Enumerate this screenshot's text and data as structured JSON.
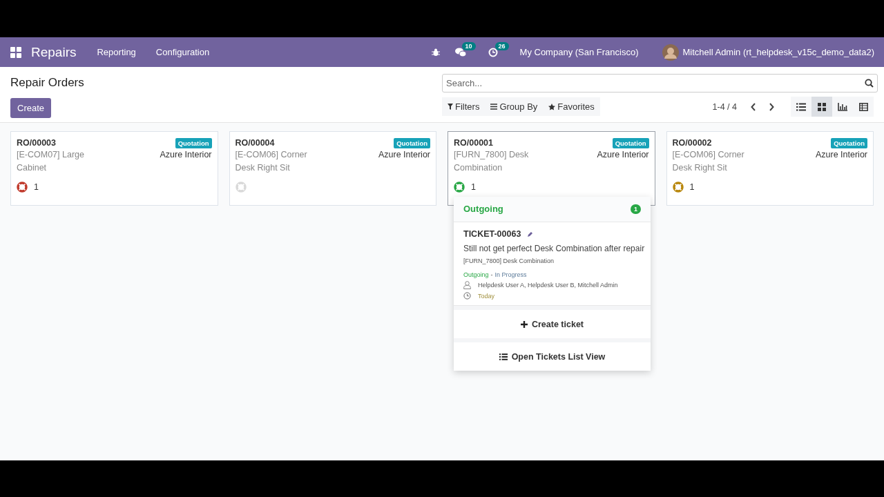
{
  "navbar": {
    "app_name": "Repairs",
    "menu": [
      "Reporting",
      "Configuration"
    ],
    "messages_count": "10",
    "activities_count": "26",
    "company": "My Company (San Francisco)",
    "user": "Mitchell Admin (rt_helpdesk_v15c_demo_data2)"
  },
  "control_panel": {
    "title": "Repair Orders",
    "create_button": "Create",
    "search": {
      "placeholder": "Search..."
    },
    "filters": [
      "Filters",
      "Group By",
      "Favorites"
    ],
    "pager": "1-4 / 4",
    "views": [
      {
        "kind": "list",
        "selected": false
      },
      {
        "kind": "kanban",
        "selected": true
      },
      {
        "kind": "graph",
        "selected": false
      },
      {
        "kind": "pivot",
        "selected": false
      }
    ]
  },
  "cards": [
    {
      "reference": "RO/00003",
      "status": "Quotation",
      "product": "[E-COM07] Large Cabinet",
      "customer": "Azure Interior",
      "color": "#c0392b",
      "ticket_count": "1",
      "popup_open": false
    },
    {
      "reference": "RO/00004",
      "status": "Quotation",
      "product": "[E-COM06] Corner Desk Right Sit",
      "customer": "Azure Interior",
      "color": "#d9d9d9",
      "popup_open": false
    },
    {
      "reference": "RO/00001",
      "status": "Quotation",
      "product": "[FURN_7800] Desk Combination",
      "customer": "Azure Interior",
      "color": "#28a745",
      "ticket_count": "1",
      "popup_open": true
    },
    {
      "reference": "RO/00002",
      "status": "Quotation",
      "product": "[E-COM06] Corner Desk Right Sit",
      "customer": "Azure Interior",
      "color": "#b8860b",
      "ticket_count": "1",
      "popup_open": false
    }
  ],
  "ticket_popup": {
    "stage": "Outgoing",
    "stage_count": "1",
    "ticket": {
      "number": "TICKET-00063",
      "title": "Still not get perfect Desk Combination after repair",
      "product": "[FURN_7800] Desk Combination",
      "stage": "Outgoing",
      "separator": "-",
      "status": "In Progress",
      "assignees": "Helpdesk User A, Helpdesk User B, Mitchell Admin",
      "deadline": "Today"
    },
    "create_button": "Create ticket",
    "list_button": "Open Tickets List View"
  }
}
